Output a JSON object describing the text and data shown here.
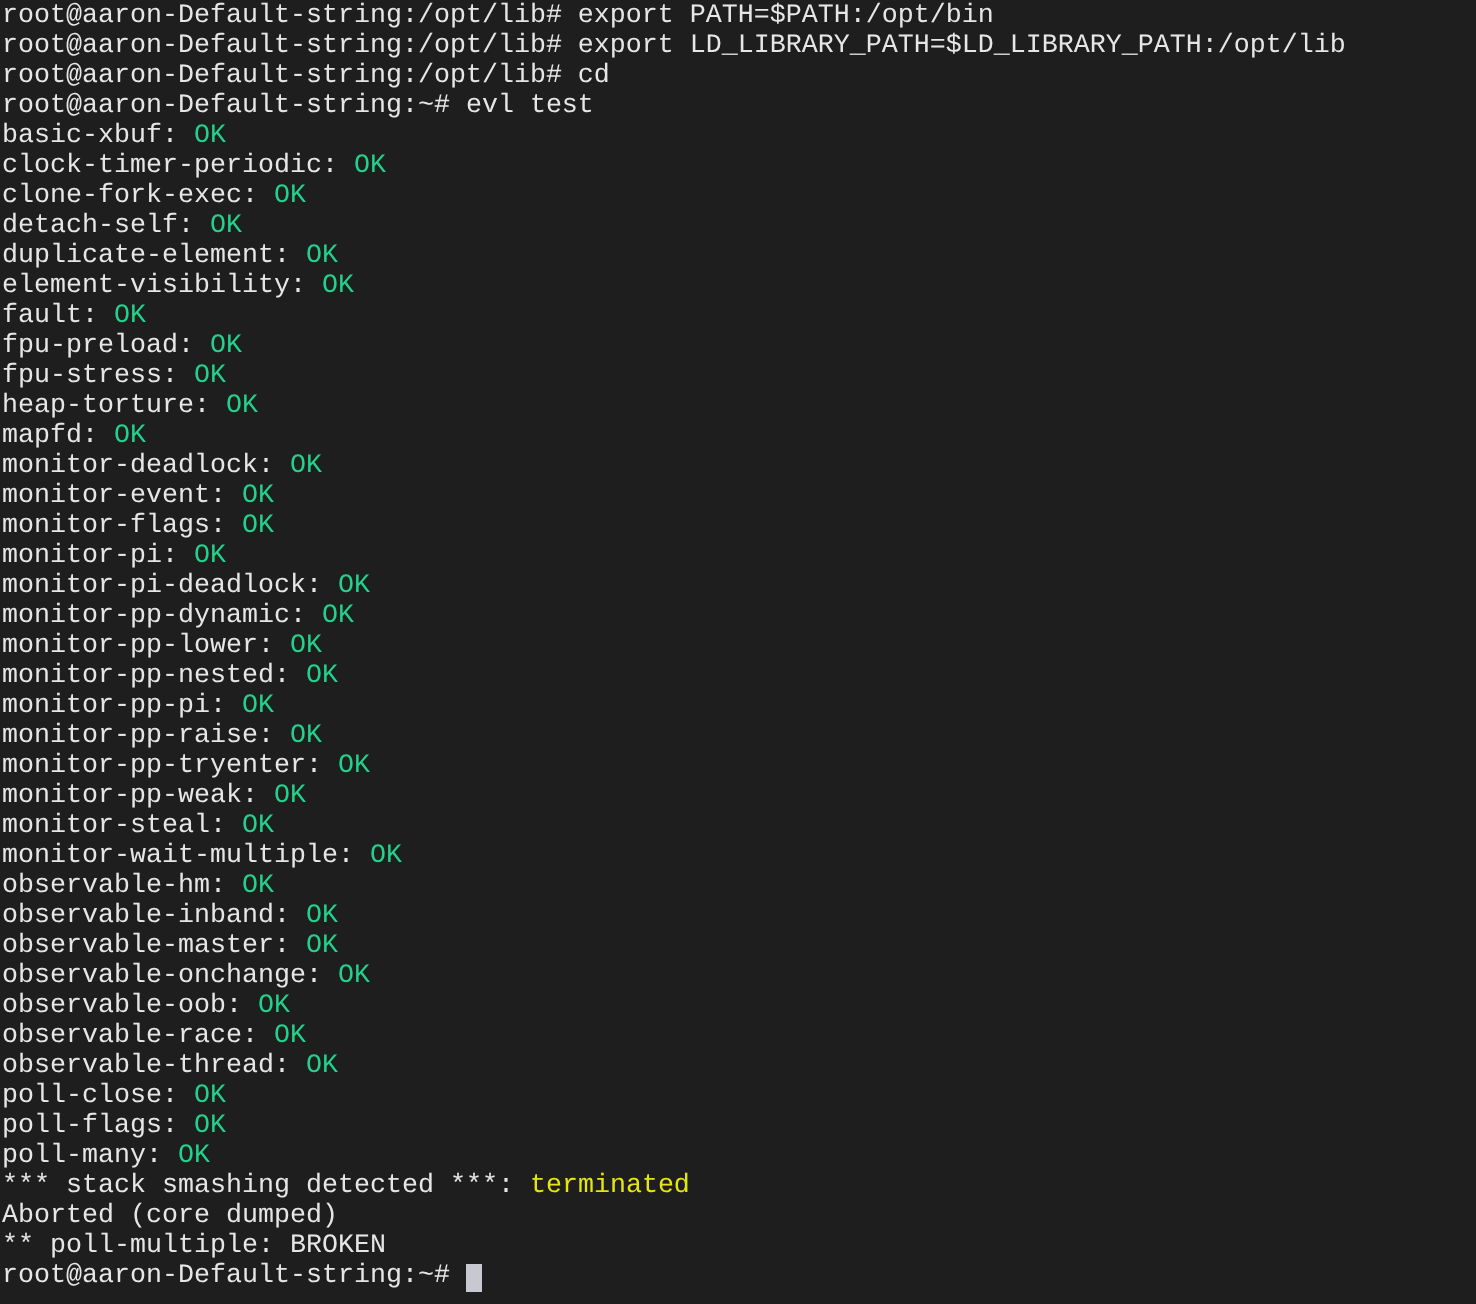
{
  "terminal": {
    "lines": [
      {
        "kind": "plain",
        "text": "root@aaron-Default-string:/opt/lib# export PATH=$PATH:/opt/bin"
      },
      {
        "kind": "plain",
        "text": "root@aaron-Default-string:/opt/lib# export LD_LIBRARY_PATH=$LD_LIBRARY_PATH:/opt/lib"
      },
      {
        "kind": "plain",
        "text": "root@aaron-Default-string:/opt/lib# cd"
      },
      {
        "kind": "plain",
        "text": "root@aaron-Default-string:~# evl test"
      },
      {
        "kind": "result",
        "name": "basic-xbuf:",
        "status": "OK",
        "color": "#23d18b"
      },
      {
        "kind": "result",
        "name": "clock-timer-periodic:",
        "status": "OK",
        "color": "#23d18b"
      },
      {
        "kind": "result",
        "name": "clone-fork-exec:",
        "status": "OK",
        "color": "#23d18b"
      },
      {
        "kind": "result",
        "name": "detach-self:",
        "status": "OK",
        "color": "#23d18b"
      },
      {
        "kind": "result",
        "name": "duplicate-element:",
        "status": "OK",
        "color": "#23d18b"
      },
      {
        "kind": "result",
        "name": "element-visibility:",
        "status": "OK",
        "color": "#23d18b"
      },
      {
        "kind": "result",
        "name": "fault:",
        "status": "OK",
        "color": "#23d18b"
      },
      {
        "kind": "result",
        "name": "fpu-preload:",
        "status": "OK",
        "color": "#23d18b"
      },
      {
        "kind": "result",
        "name": "fpu-stress:",
        "status": "OK",
        "color": "#23d18b"
      },
      {
        "kind": "result",
        "name": "heap-torture:",
        "status": "OK",
        "color": "#23d18b"
      },
      {
        "kind": "result",
        "name": "mapfd:",
        "status": "OK",
        "color": "#23d18b"
      },
      {
        "kind": "result",
        "name": "monitor-deadlock:",
        "status": "OK",
        "color": "#23d18b"
      },
      {
        "kind": "result",
        "name": "monitor-event:",
        "status": "OK",
        "color": "#23d18b"
      },
      {
        "kind": "result",
        "name": "monitor-flags:",
        "status": "OK",
        "color": "#23d18b"
      },
      {
        "kind": "result",
        "name": "monitor-pi:",
        "status": "OK",
        "color": "#23d18b"
      },
      {
        "kind": "result",
        "name": "monitor-pi-deadlock:",
        "status": "OK",
        "color": "#23d18b"
      },
      {
        "kind": "result",
        "name": "monitor-pp-dynamic:",
        "status": "OK",
        "color": "#23d18b"
      },
      {
        "kind": "result",
        "name": "monitor-pp-lower:",
        "status": "OK",
        "color": "#23d18b"
      },
      {
        "kind": "result",
        "name": "monitor-pp-nested:",
        "status": "OK",
        "color": "#23d18b"
      },
      {
        "kind": "result",
        "name": "monitor-pp-pi:",
        "status": "OK",
        "color": "#23d18b"
      },
      {
        "kind": "result",
        "name": "monitor-pp-raise:",
        "status": "OK",
        "color": "#23d18b"
      },
      {
        "kind": "result",
        "name": "monitor-pp-tryenter:",
        "status": "OK",
        "color": "#23d18b"
      },
      {
        "kind": "result",
        "name": "monitor-pp-weak:",
        "status": "OK",
        "color": "#23d18b"
      },
      {
        "kind": "result",
        "name": "monitor-steal:",
        "status": "OK",
        "color": "#23d18b"
      },
      {
        "kind": "result",
        "name": "monitor-wait-multiple:",
        "status": "OK",
        "color": "#23d18b"
      },
      {
        "kind": "result",
        "name": "observable-hm:",
        "status": "OK",
        "color": "#23d18b"
      },
      {
        "kind": "result",
        "name": "observable-inband:",
        "status": "OK",
        "color": "#23d18b"
      },
      {
        "kind": "result",
        "name": "observable-master:",
        "status": "OK",
        "color": "#23d18b"
      },
      {
        "kind": "result",
        "name": "observable-onchange:",
        "status": "OK",
        "color": "#23d18b"
      },
      {
        "kind": "result",
        "name": "observable-oob:",
        "status": "OK",
        "color": "#23d18b"
      },
      {
        "kind": "result",
        "name": "observable-race:",
        "status": "OK",
        "color": "#23d18b"
      },
      {
        "kind": "result",
        "name": "observable-thread:",
        "status": "OK",
        "color": "#23d18b"
      },
      {
        "kind": "result",
        "name": "poll-close:",
        "status": "OK",
        "color": "#23d18b"
      },
      {
        "kind": "result",
        "name": "poll-flags:",
        "status": "OK",
        "color": "#23d18b"
      },
      {
        "kind": "result",
        "name": "poll-many:",
        "status": "OK",
        "color": "#23d18b"
      },
      {
        "kind": "result",
        "name": "*** stack smashing detected ***:",
        "status": "terminated",
        "color": "#e5e510"
      },
      {
        "kind": "plain",
        "text": "Aborted (core dumped)"
      },
      {
        "kind": "plain",
        "text": "** poll-multiple: BROKEN"
      },
      {
        "kind": "prompt",
        "text": "root@aaron-Default-string:~#",
        "cursor": true
      }
    ]
  }
}
